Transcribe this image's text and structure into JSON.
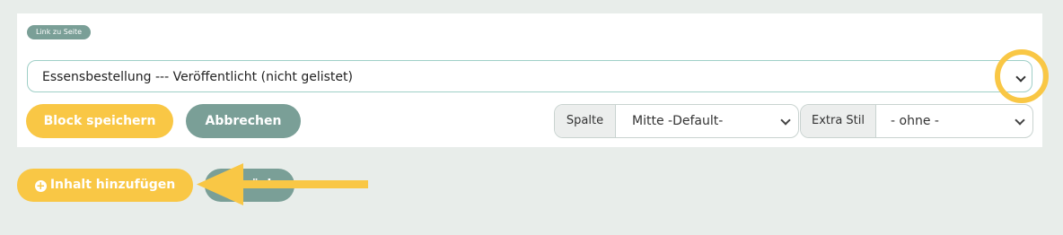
{
  "panel": {
    "tag_label": "Link zu Seite",
    "page_select": {
      "value": "Essensbestellung --- Veröffentlicht (nicht gelistet)"
    },
    "save_button": "Block speichern",
    "cancel_button": "Abbrechen",
    "column": {
      "label": "Spalte",
      "value": "Mitte -Default-"
    },
    "extra_style": {
      "label": "Extra Stil",
      "value": "- ohne -"
    }
  },
  "footer": {
    "add_content_button": "Inhalt hinzufügen",
    "add_icon": "plus-circle-icon",
    "back_button": "ück"
  },
  "colors": {
    "accent_yellow": "#f9c745",
    "teal": "#7a9f97",
    "background": "#e8edea"
  }
}
